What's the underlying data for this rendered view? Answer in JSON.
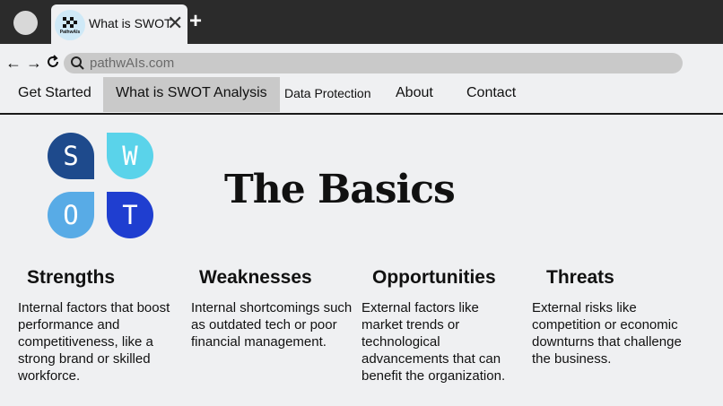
{
  "browser": {
    "tab_title": "What is SWOT",
    "favicon_text": "PathwAIs",
    "url": "pathwAIs.com",
    "back_icon": "arrow-left-icon",
    "forward_icon": "arrow-right-icon",
    "reload_icon": "reload-icon",
    "close_tab_icon": "close-icon",
    "new_tab_icon": "plus-icon"
  },
  "nav": {
    "items": [
      {
        "label": "Get Started"
      },
      {
        "label": "What is SWOT Analysis",
        "active": true
      },
      {
        "label": "Data Protection"
      },
      {
        "label": "About"
      },
      {
        "label": "Contact"
      }
    ]
  },
  "hero": {
    "title": "The Basics",
    "logo_letters": [
      "S",
      "W",
      "O",
      "T"
    ],
    "logo_colors": [
      "#1e4a8c",
      "#5ad3ea",
      "#58abe6",
      "#1f3ed0"
    ]
  },
  "sections": [
    {
      "title": "Strengths",
      "body": "Internal factors that boost performance and competitiveness, like a strong brand or skilled workforce."
    },
    {
      "title": "Weaknesses",
      "body": "Internal shortcomings such as outdated tech or poor financial management."
    },
    {
      "title": "Opportunities",
      "body": "External factors like market trends or technological advancements that can benefit the organization."
    },
    {
      "title": "Threats",
      "body": "External risks like competition or economic downturns that challenge the business."
    }
  ]
}
